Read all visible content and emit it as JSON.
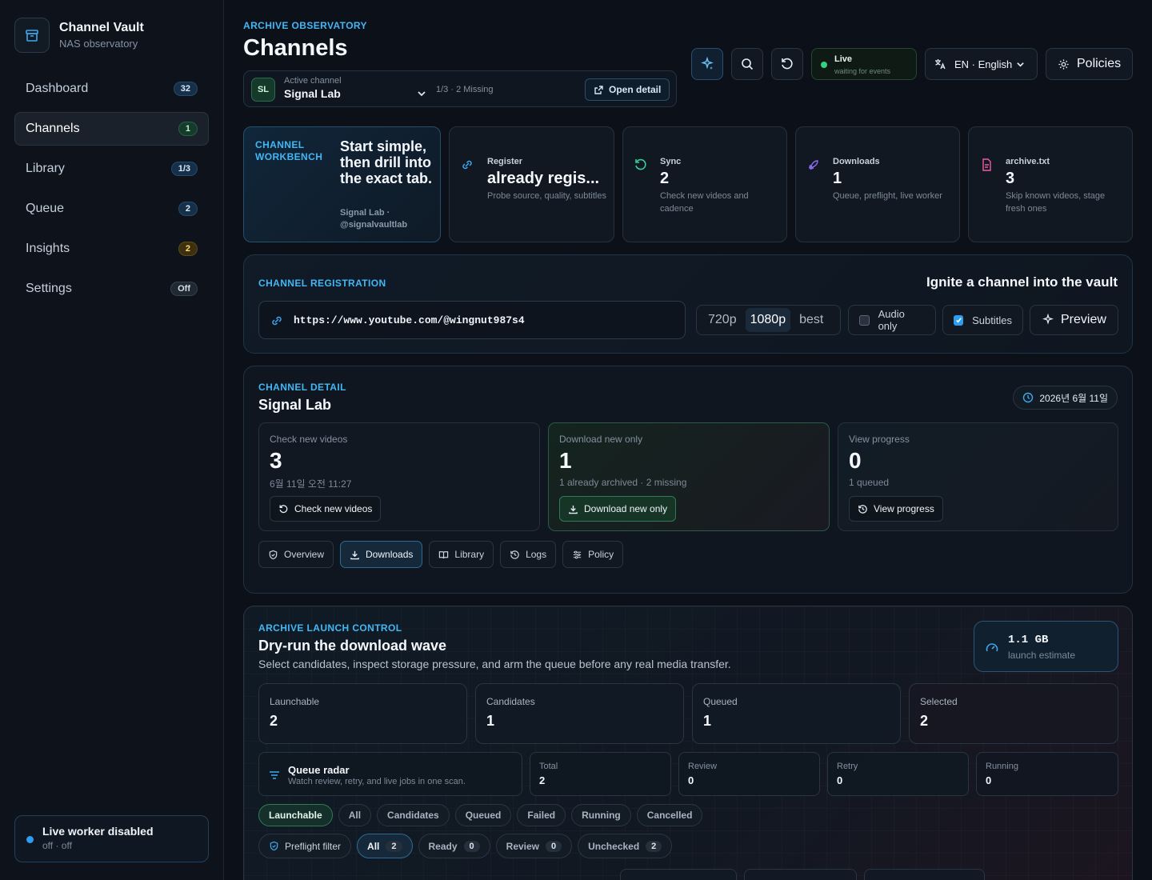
{
  "sidebar": {
    "brand_title": "Channel Vault",
    "brand_sub": "NAS observatory",
    "items": [
      {
        "label": "Dashboard",
        "badge": "32"
      },
      {
        "label": "Channels",
        "badge": "1"
      },
      {
        "label": "Library",
        "badge": "1/3"
      },
      {
        "label": "Queue",
        "badge": "2"
      },
      {
        "label": "Insights",
        "badge": "2"
      },
      {
        "label": "Settings",
        "badge": "Off"
      }
    ],
    "worker_title": "Live worker disabled",
    "worker_sub": "off · off"
  },
  "header": {
    "eyebrow": "ARCHIVE OBSERVATORY",
    "title": "Channels",
    "channel_avatar": "SL",
    "active_label": "Active channel",
    "active_value": "Signal Lab",
    "missing": "1/3 · 2 Missing",
    "open_detail": "Open detail",
    "live_label": "Live",
    "live_sub": "waiting for events",
    "language": "EN · English",
    "policies": "Policies"
  },
  "workbench": {
    "eyebrow": "CHANNEL WORKBENCH",
    "headline": "Start simple, then drill into the exact tab.",
    "sub": "Signal Lab · @signalvaultlab"
  },
  "stats": [
    {
      "label": "Register",
      "value": "already regis...",
      "desc": "Probe source, quality, subtitles",
      "icon": "link-icon",
      "color": "#3ea8f0"
    },
    {
      "label": "Sync",
      "value": "2",
      "desc": "Check new videos and cadence",
      "icon": "refresh-icon",
      "color": "#2fd39a"
    },
    {
      "label": "Downloads",
      "value": "1",
      "desc": "Queue, preflight, live worker",
      "icon": "rocket-icon",
      "color": "#8b6cf0"
    },
    {
      "label": "archive.txt",
      "value": "3",
      "desc": "Skip known videos, stage fresh ones",
      "icon": "file-icon",
      "color": "#f05aa8"
    }
  ],
  "registration": {
    "eyebrow": "CHANNEL REGISTRATION",
    "headline": "Ignite a channel into the vault",
    "url": "https://www.youtube.com/@wingnut987s4",
    "qualities": [
      "720p",
      "1080p",
      "best"
    ],
    "selected_quality": "1080p",
    "audio_only": "Audio only",
    "subtitles": "Subtitles",
    "preview": "Preview"
  },
  "detail": {
    "eyebrow": "CHANNEL DETAIL",
    "title": "Signal Lab",
    "date": "2026년 6월 11일",
    "cards": [
      {
        "label": "Check new videos",
        "value": "3",
        "sub": "6월 11일 오전 11:27",
        "button": "Check new videos"
      },
      {
        "label": "Download new only",
        "value": "1",
        "sub": "1 already archived · 2 missing",
        "button": "Download new only"
      },
      {
        "label": "View progress",
        "value": "0",
        "sub": "1 queued",
        "button": "View progress"
      }
    ],
    "tabs": [
      "Overview",
      "Downloads",
      "Library",
      "Logs",
      "Policy"
    ],
    "active_tab": "Downloads"
  },
  "launch": {
    "eyebrow": "ARCHIVE LAUNCH CONTROL",
    "title": "Dry-run the download wave",
    "sub": "Select candidates, inspect storage pressure, and arm the queue before any real media transfer.",
    "estimate": "1.1 GB",
    "estimate_label": "launch estimate",
    "metrics": [
      {
        "label": "Launchable",
        "value": "2"
      },
      {
        "label": "Candidates",
        "value": "1"
      },
      {
        "label": "Queued",
        "value": "1"
      },
      {
        "label": "Selected",
        "value": "2"
      }
    ],
    "radar_title": "Queue radar",
    "radar_sub": "Watch review, retry, and live jobs in one scan.",
    "radar_stats": [
      {
        "label": "Total",
        "value": "2"
      },
      {
        "label": "Review",
        "value": "0"
      },
      {
        "label": "Retry",
        "value": "0"
      },
      {
        "label": "Running",
        "value": "0"
      }
    ],
    "filters": [
      "Launchable",
      "All",
      "Candidates",
      "Queued",
      "Failed",
      "Running",
      "Cancelled"
    ],
    "active_filter": "Launchable",
    "preflight_label": "Preflight filter",
    "preflight": [
      {
        "label": "All",
        "count": "2"
      },
      {
        "label": "Ready",
        "count": "0"
      },
      {
        "label": "Review",
        "count": "0"
      },
      {
        "label": "Unchecked",
        "count": "2"
      }
    ]
  }
}
